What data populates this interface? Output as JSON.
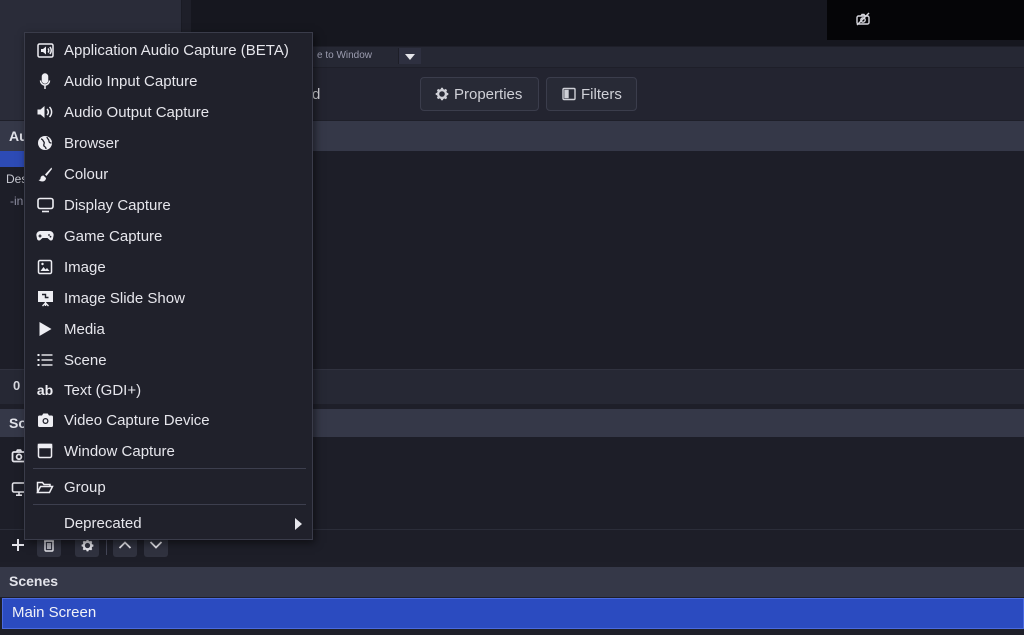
{
  "toolbar": {
    "scale_text": "e to Window",
    "source_name_partial": "d",
    "properties_label": "Properties",
    "filters_label": "Filters"
  },
  "mixer": {
    "title_partial": "Au",
    "desc_partial": "Des",
    "desc2_partial": "-in",
    "footer_partial": "0"
  },
  "sources": {
    "title_partial": "So",
    "icons": [
      "camera-icon",
      "monitor-icon"
    ],
    "toolbar": [
      "plus-icon",
      "trash-icon",
      "gear-icon",
      "chevron-up-icon",
      "chevron-down-icon"
    ]
  },
  "scenes": {
    "title": "Scenes",
    "items": [
      {
        "label": "Main Screen",
        "selected": true
      }
    ]
  },
  "context_menu": {
    "items": [
      {
        "label": "Application Audio Capture (BETA)",
        "icon": "app-audio-icon"
      },
      {
        "label": "Audio Input Capture",
        "icon": "microphone-icon"
      },
      {
        "label": "Audio Output Capture",
        "icon": "speaker-icon"
      },
      {
        "label": "Browser",
        "icon": "globe-icon"
      },
      {
        "label": "Colour",
        "icon": "brush-icon"
      },
      {
        "label": "Display Capture",
        "icon": "monitor-icon"
      },
      {
        "label": "Game Capture",
        "icon": "gamepad-icon"
      },
      {
        "label": "Image",
        "icon": "image-icon"
      },
      {
        "label": "Image Slide Show",
        "icon": "slideshow-icon"
      },
      {
        "label": "Media",
        "icon": "play-icon"
      },
      {
        "label": "Scene",
        "icon": "list-icon"
      },
      {
        "label": "Text (GDI+)",
        "icon": "text-icon"
      },
      {
        "label": "Video Capture Device",
        "icon": "camera-icon"
      },
      {
        "label": "Window Capture",
        "icon": "window-icon"
      }
    ],
    "group_label": "Group",
    "deprecated_label": "Deprecated"
  }
}
